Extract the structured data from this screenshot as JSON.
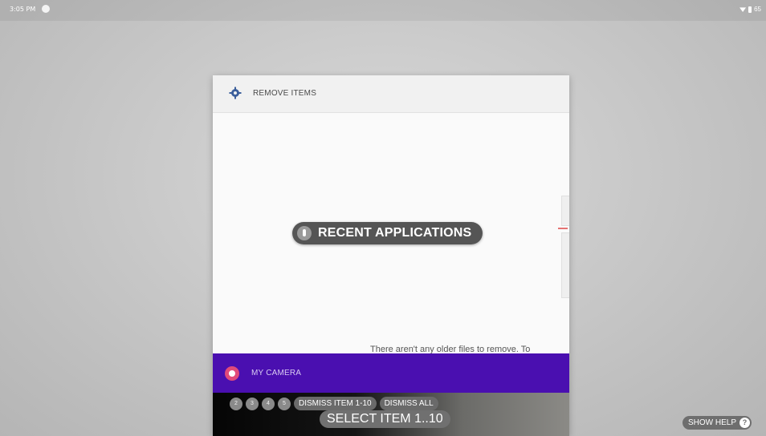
{
  "status_bar": {
    "time": "3:05 PM",
    "battery": "65"
  },
  "recents": {
    "top_card": {
      "title": "REMOVE ITEMS",
      "body_text": "There aren't any older files to remove. To"
    },
    "camera_card": {
      "title": "MY CAMERA"
    }
  },
  "overlay": {
    "recent_apps_label": "RECENT APPLICATIONS",
    "number_badges": [
      "2",
      "3",
      "4",
      "5"
    ],
    "dismiss_item_label": "DISMISS ITEM 1-10",
    "dismiss_all_label": "DISMISS ALL",
    "select_item_label": "SELECT ITEM 1..10",
    "show_help_label": "SHOW HELP",
    "help_glyph": "?"
  },
  "colors": {
    "camera_header": "#4a0fb0",
    "camera_icon": "#e14a7a",
    "overlay_pill": "#6a6a6a"
  },
  "icons": {
    "header_app_icon": "settings-gear-icon",
    "camera_app_icon": "camera-icon",
    "voice_icon": "microphone-icon"
  }
}
